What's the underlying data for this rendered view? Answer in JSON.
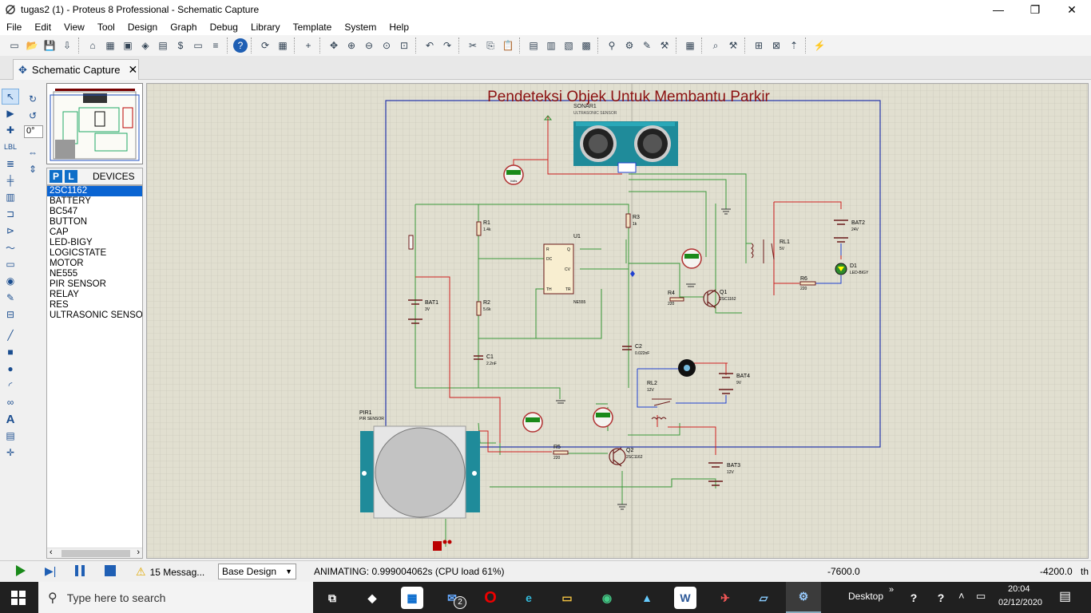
{
  "window": {
    "title": "tugas2 (1) - Proteus 8 Professional - Schematic Capture",
    "minimize": "—",
    "maximize": "❐",
    "close": "✕"
  },
  "menu": [
    "File",
    "Edit",
    "View",
    "Tool",
    "Design",
    "Graph",
    "Debug",
    "Library",
    "Template",
    "System",
    "Help"
  ],
  "tab": {
    "label": "Schematic Capture",
    "close": "✕"
  },
  "rotation": "0°",
  "devices": {
    "p_label": "P",
    "l_label": "L",
    "header": "DEVICES",
    "items": [
      "2SC1162",
      "BATTERY",
      "BC547",
      "BUTTON",
      "CAP",
      "LED-BIGY",
      "LOGICSTATE",
      "MOTOR",
      "NE555",
      "PIR SENSOR",
      "RELAY",
      "RES",
      "ULTRASONIC SENSOR"
    ],
    "selected": 0
  },
  "schematic": {
    "title": "Pendeteksi Objek Untuk Membantu Parkir",
    "labels": {
      "sonar": "SONAR1",
      "sonar_sub": "ULTRASONIC SENSOR",
      "text_tag": "<TEXT>",
      "r1": "R1",
      "r1v": "1.4k",
      "r2": "R2",
      "r2v": "5.6k",
      "r3": "R3",
      "r3v": "1k",
      "r4": "R4",
      "r4v": "220",
      "r5": "R5",
      "r5v": "220",
      "r6": "R6",
      "r6v": "220",
      "c1": "C1",
      "c1v": "2.2nF",
      "c2": "C2",
      "c2v": "0.022nF",
      "u1": "U1",
      "u1p": "NE555",
      "q1": "Q1",
      "q1p": "2SC1162",
      "q2": "Q2",
      "q2p": "2SC1162",
      "bat1": "BAT1",
      "bat1v": "3V",
      "bat2": "BAT2",
      "bat2v": "24V",
      "bat3": "BAT3",
      "bat3v": "12V",
      "bat4": "BAT4",
      "bat4v": "9V",
      "rl1": "RL1",
      "rl1v": "5V",
      "rl2": "RL2",
      "rl2v": "12V",
      "d1": "D1",
      "d1p": "LED-BIGY",
      "pir": "PIR1",
      "pir_sub": "PIR SENSOR",
      "volts": "Volts",
      "pin_q": "Q",
      "pin_dc": "DC",
      "pin_th": "TH",
      "pin_r": "R",
      "pin_cv": "CV",
      "pin_tr": "TR",
      "pin_vcc": "VCC",
      "pin_gnd": "GND"
    }
  },
  "status": {
    "messages": "15 Messag...",
    "design": "Base Design",
    "animating": "ANIMATING: 0.999004062s (CPU load 61%)",
    "x": "-7600.0",
    "y": "-4200.0",
    "unit": "th"
  },
  "taskbar": {
    "search": "Type here to search",
    "desktop": "Desktop",
    "time": "20:04",
    "date": "02/12/2020",
    "mail_badge": "2"
  }
}
